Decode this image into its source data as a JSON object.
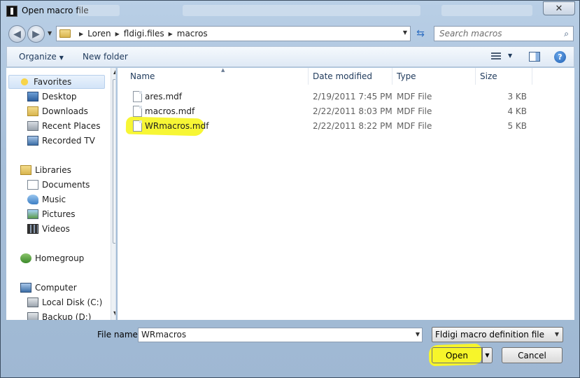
{
  "window": {
    "title": "Open macro file",
    "close_symbol": "✕"
  },
  "nav": {
    "back_symbol": "◀",
    "forward_symbol": "▶",
    "breadcrumbs": [
      "Loren",
      "fldigi.files",
      "macros"
    ],
    "search_placeholder": "Search macros"
  },
  "toolbar": {
    "organize": "Organize",
    "new_folder": "New folder",
    "help": "?"
  },
  "sidebar": {
    "favorites": "Favorites",
    "favorite_items": [
      "Desktop",
      "Downloads",
      "Recent Places",
      "Recorded TV"
    ],
    "libraries": "Libraries",
    "library_items": [
      "Documents",
      "Music",
      "Pictures",
      "Videos"
    ],
    "homegroup": "Homegroup",
    "computer": "Computer",
    "computer_items": [
      "Local Disk (C:)",
      "Backup (D:)"
    ]
  },
  "columns": {
    "name": "Name",
    "date": "Date modified",
    "type": "Type",
    "size": "Size"
  },
  "files": [
    {
      "name": "ares.mdf",
      "date": "2/19/2011 7:45 PM",
      "type": "MDF File",
      "size": "3 KB"
    },
    {
      "name": "macros.mdf",
      "date": "2/22/2011 8:03 PM",
      "type": "MDF File",
      "size": "4 KB"
    },
    {
      "name": "WRmacros.mdf",
      "date": "2/22/2011 8:22 PM",
      "type": "MDF File",
      "size": "5 KB"
    }
  ],
  "bottom": {
    "file_name_label": "File name:",
    "file_name_value": "WRmacros",
    "filter": "Fldigi macro definition file",
    "open": "Open",
    "cancel": "Cancel"
  },
  "colors": {
    "highlight": "#f7f52a",
    "chrome": "#a7bfd9"
  }
}
